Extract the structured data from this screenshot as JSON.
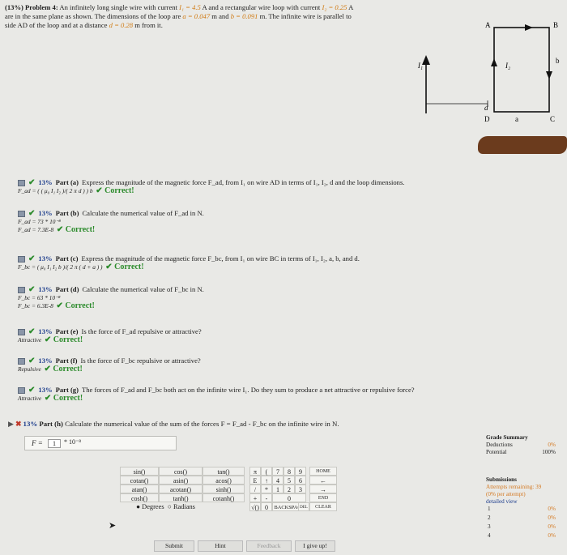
{
  "problem": {
    "prefix": "(13%) Problem 4:",
    "text1": " An infinitely long single wire with current ",
    "I1": "I₁ = 4.5",
    "text2": " A and a rectangular wire loop with current ",
    "I2": "I₂ = 0.25",
    "text3": " A are in the same plane as shown. The dimensions of the loop are ",
    "a": "a = 0.047",
    "text4": " m and ",
    "b": "b = 0.091",
    "text5": " m. The infinite wire is parallel to side AD of the loop and at a distance ",
    "d": "d = 0.28",
    "text6": " m from it."
  },
  "diagram": {
    "label_I1": "I₁",
    "label_I2": "I₂",
    "label_A": "A",
    "label_B": "B",
    "label_b": "b",
    "label_d": "d",
    "label_D": "D",
    "label_a": "a",
    "label_C": "C"
  },
  "parts": [
    {
      "pct": "13%",
      "title": "Part (a)",
      "question": "Express the magnitude of the magnetic force F_ad, from I₁ on wire AD in terms of I₁, I₂, d and the loop dimensions.",
      "answers": [
        "F_ad = ( ( μ₀ I₁ I₂ )/( 2 π d ) ) b"
      ],
      "correct": "✔ Correct!"
    },
    {
      "pct": "13%",
      "title": "Part (b)",
      "question": "Calculate the numerical value of F_ad in N.",
      "answers": [
        "F_ad = 73 * 10⁻⁸",
        "F_ad = 7.3E-8"
      ],
      "correct": "✔ Correct!"
    },
    {
      "pct": "13%",
      "title": "Part (c)",
      "question": "Express the magnitude of the magnetic force F_bc, from I₁ on wire BC in terms of I₁, I₂, a, b, and d.",
      "answers": [
        "F_bc = ( μ₀ I₁ I₂ b )/( 2 π ( d + a ) )"
      ],
      "correct": "✔ Correct!"
    },
    {
      "pct": "13%",
      "title": "Part (d)",
      "question": "Calculate the numerical value of F_bc in N.",
      "answers": [
        "F_bc = 63 * 10⁻⁸",
        "F_bc = 6.3E-8"
      ],
      "correct": "✔ Correct!"
    },
    {
      "pct": "13%",
      "title": "Part (e)",
      "question": "Is the force of F_ad repulsive or attractive?",
      "answers": [
        "Attractive"
      ],
      "correct": "✔ Correct!"
    },
    {
      "pct": "13%",
      "title": "Part (f)",
      "question": "Is the force of F_bc repulsive or attractive?",
      "answers": [
        "Repulsive"
      ],
      "correct": "✔ Correct!"
    },
    {
      "pct": "13%",
      "title": "Part (g)",
      "question": "The forces of F_ad and F_bc both act on the infinite wire I₁. Do they sum to produce a net attractive or repulsive force?",
      "answers": [
        "Attractive"
      ],
      "correct": "✔ Correct!"
    }
  ],
  "partH": {
    "pct": "13%",
    "title": "Part (h)",
    "question": "Calculate the numerical value of the sum of the forces F = F_ad - F_bc on the infinite wire in N.",
    "f_label": "F =",
    "input_value": "1",
    "power": "* 10⁻⁸"
  },
  "keypad": {
    "functions": [
      [
        "sin()",
        "cos()",
        "tan()"
      ],
      [
        "cotan()",
        "asin()",
        "acos()"
      ],
      [
        "atan()",
        "acotan()",
        "sinh()"
      ],
      [
        "cosh()",
        "tanh()",
        "cotanh()"
      ]
    ],
    "degrees": "Degrees",
    "radians": "Radians",
    "col_pi": [
      "π",
      "E",
      "/",
      "+",
      "√()"
    ],
    "col_paren": [
      "(",
      "↑",
      "",
      "-",
      "0"
    ],
    "row1": [
      "7",
      "8",
      "9"
    ],
    "row2": [
      "4",
      "5",
      "6"
    ],
    "row3": [
      "1",
      "2",
      "3"
    ],
    "zero": "0",
    "backspace": "BACKSPACE",
    "del": "DEL",
    "clear": "CLEAR",
    "home": "HOME",
    "end": "END",
    "star": "*",
    "arrow_up": "↑",
    "arrow_left": "←",
    "arrow_right": "→"
  },
  "buttons": {
    "submit": "Submit",
    "hint": "Hint",
    "feedback": "Feedback",
    "give_up": "I give up!"
  },
  "grade_summary": {
    "title": "Grade Summary",
    "deductions_label": "Deductions",
    "deductions_value": "0%",
    "potential_label": "Potential",
    "potential_value": "100%"
  },
  "submissions": {
    "title": "Submissions",
    "remaining": "Attempts remaining: 39",
    "per_attempt": "(0% per attempt)",
    "detailed": "detailed view",
    "rows": [
      {
        "n": "1",
        "v": "0%"
      },
      {
        "n": "2",
        "v": "0%"
      },
      {
        "n": "3",
        "v": "0%"
      },
      {
        "n": "4",
        "v": "0%"
      }
    ]
  },
  "colors": {
    "accent_orange": "#d07a12",
    "correct_green": "#2a8a2a",
    "pct_blue": "#1d3d8c"
  }
}
